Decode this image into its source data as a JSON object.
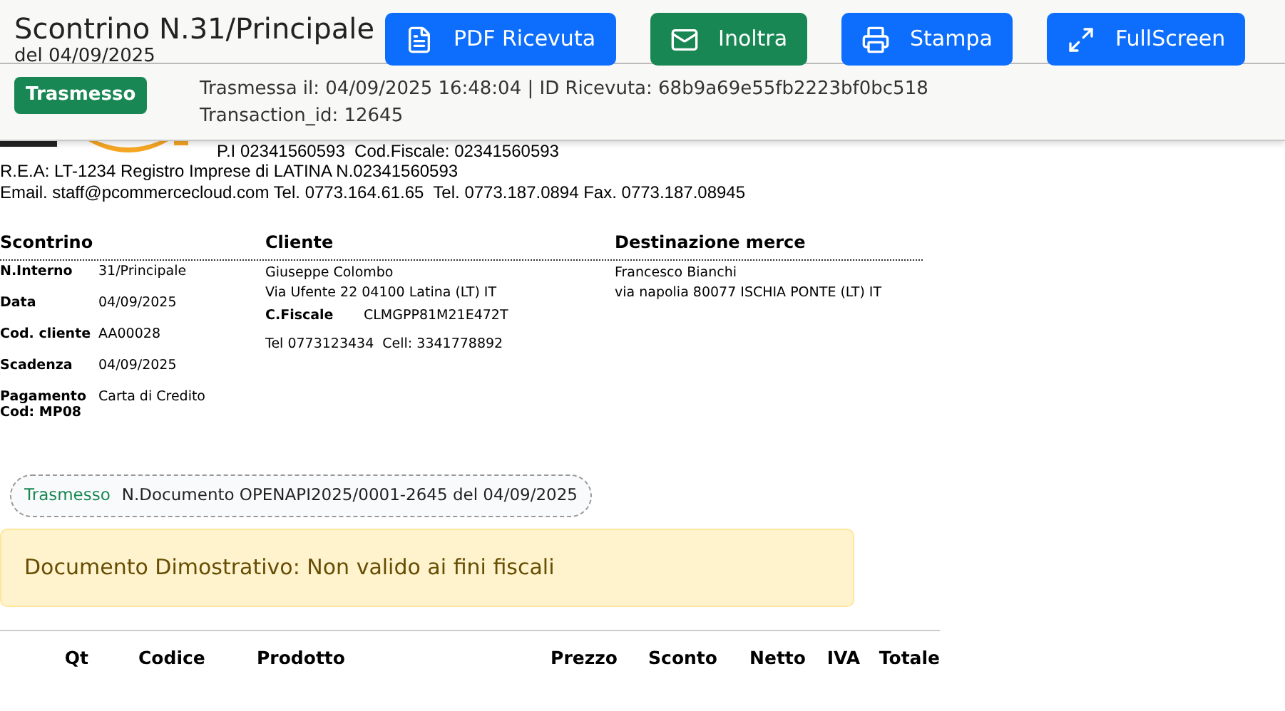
{
  "header": {
    "title": "Scontrino N.31/Principale",
    "subtitle": "del 04/09/2025",
    "buttons": [
      {
        "label": "PDF Ricevuta",
        "kind": "pdf",
        "color": "#0d6efd"
      },
      {
        "label": "Inoltra",
        "kind": "mail",
        "color": "#198754"
      },
      {
        "label": "Stampa",
        "kind": "print",
        "color": "#0d6efd"
      },
      {
        "label": "FullScreen",
        "kind": "fullscreen",
        "color": "#0d6efd"
      }
    ],
    "status_badge": "Trasmesso",
    "status_lines": [
      "Trasmessa il: 04/09/2025 16:48:04 | ID Ricevuta: 68b9a69e55fb2223bf0bc518",
      "Transaction_id: 12645"
    ]
  },
  "company": {
    "tax_line": "P.I 02341560593  Cod.Fiscale: 02341560593",
    "rea_line": "R.E.A: LT-1234 Registro Imprese di LATINA N.02341560593",
    "contact_line": "Email. staff@pcommercecloud.com Tel. 0773.164.61.65  Tel. 0773.187.0894 Fax. 0773.187.08945"
  },
  "receipt": {
    "heading": "Scontrino",
    "fields": [
      {
        "label": "N.Interno",
        "value": "31/Principale"
      },
      {
        "label": "Data",
        "value": "04/09/2025"
      },
      {
        "label": "Cod. cliente",
        "value": "AA00028"
      },
      {
        "label": "Scadenza",
        "value": "04/09/2025"
      },
      {
        "label": "Pagamento Cod: MP08",
        "value": "Carta di Credito"
      }
    ]
  },
  "customer": {
    "heading": "Cliente",
    "name": "Giuseppe Colombo",
    "address": "Via Ufente 22 04100 Latina (LT) IT",
    "fiscal_label": "C.Fiscale",
    "fiscal_value": "CLMGPP81M21E472T",
    "phones": "Tel 0773123434  Cell: 3341778892"
  },
  "destination": {
    "heading": "Destinazione merce",
    "name": "Francesco Bianchi",
    "address": "via napolia 80077 ISCHIA PONTE (LT) IT"
  },
  "document_status": {
    "status": "Trasmesso",
    "text": "N.Documento OPENAPI2025/0001-2645 del 04/09/2025"
  },
  "alert": "Documento Dimostrativo: Non valido ai fini fiscali",
  "table": {
    "columns": [
      "Qt",
      "Codice",
      "Prodotto",
      "Prezzo",
      "Sconto",
      "Netto",
      "IVA",
      "Totale"
    ]
  }
}
